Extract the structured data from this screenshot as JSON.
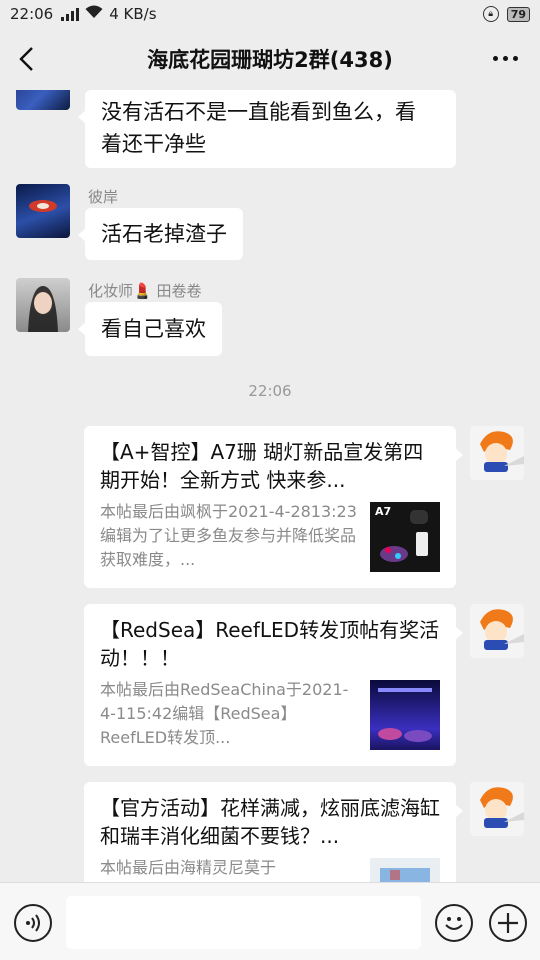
{
  "status_bar": {
    "time": "22:06",
    "network": "4 KB/s",
    "network_type": "4G",
    "battery": "79"
  },
  "header": {
    "title": "海底花园珊瑚坊2群(438)"
  },
  "messages": [
    {
      "type": "text",
      "sender": "",
      "text_lines": [
        "没有活石不是一直能看到鱼么，看",
        "着还干净些"
      ]
    },
    {
      "type": "text",
      "sender": "彼岸",
      "text_lines": [
        "活石老掉渣子"
      ]
    },
    {
      "type": "text",
      "sender": "化妆师💄 田卷卷",
      "text_lines": [
        "看自己喜欢"
      ]
    }
  ],
  "timestamp": "22:06",
  "cards": [
    {
      "title": "【A+智控】A7珊 瑚灯新品宣发第四期开始！全新方式  快来参...",
      "desc": "本帖最后由飒枫于2021-4-2813:23编辑为了让更多鱼友参与并降低奖品获取难度，...",
      "thumb_label": "A7"
    },
    {
      "title": "【RedSea】ReefLED转发顶帖有奖活动！！！",
      "desc": "本帖最后由RedSeaChina于2021-4-115:42编辑【RedSea】ReefLED转发顶...",
      "thumb_label": ""
    },
    {
      "title": "【官方活动】花样满减，炫丽底滤海缸和瑞丰消化细菌不要钱？...",
      "desc": "本帖最后由海精灵尼莫于",
      "thumb_label": ""
    }
  ],
  "input": {
    "placeholder": ""
  },
  "colors": {
    "background": "#ededed",
    "bubble": "#ffffff",
    "meta_text": "#888888"
  }
}
